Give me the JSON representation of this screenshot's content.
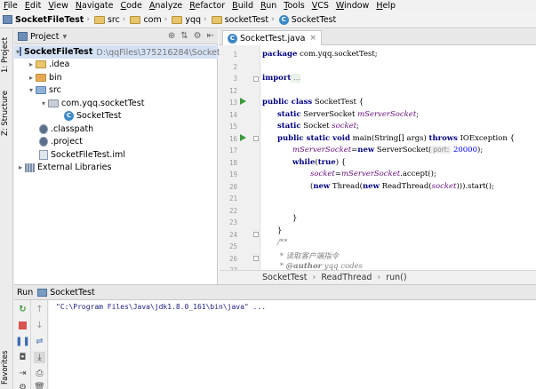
{
  "menu": [
    "File",
    "Edit",
    "View",
    "Navigate",
    "Code",
    "Analyze",
    "Refactor",
    "Build",
    "Run",
    "Tools",
    "VCS",
    "Window",
    "Help"
  ],
  "breadcrumbs": [
    "SocketFileTest",
    "src",
    "com",
    "yqq",
    "socketTest",
    "SocketTest"
  ],
  "left_strip": {
    "project_tab": "1: Project",
    "structure_tab": "Z: Structure",
    "favorites_tab": "Favorites"
  },
  "project_panel": {
    "title": "Project",
    "root_name": "SocketFileTest",
    "root_path": "D:\\qqFiles\\375216284\\Socket通信",
    "items": [
      {
        "label": ".idea"
      },
      {
        "label": "bin"
      },
      {
        "label": "src"
      },
      {
        "label": "com.yqq.socketTest"
      },
      {
        "label": "SocketTest"
      },
      {
        "label": ".classpath"
      },
      {
        "label": ".project"
      },
      {
        "label": "SocketFileTest.iml"
      },
      {
        "label": "External Libraries"
      }
    ]
  },
  "editor": {
    "tab_label": "SocketTest.java",
    "line_numbers": [
      "1",
      "2",
      "3",
      "12",
      "13",
      "14",
      "15",
      "16",
      "17",
      "18",
      "19",
      "20",
      "21",
      "22",
      "23",
      "24",
      "25",
      "26",
      "27"
    ],
    "code": {
      "package_kw": "package",
      "package_name": " com.yqq.socketTest;",
      "import_kw": "import",
      "import_rest": " ...",
      "l13_a": "public class",
      "l13_b": " SocketTest {",
      "l14_a": "static",
      "l14_b": " ServerSocket ",
      "l14_c": "mServerSocket",
      "l14_d": ";",
      "l15_a": "static",
      "l15_b": " Socket ",
      "l15_c": "socket",
      "l15_d": ";",
      "l16_a": "public static void",
      "l16_b": " main(String[] args) ",
      "l16_c": "throws",
      "l16_d": " IOException {",
      "l17_a": "mServerSocket",
      "l17_b": "=",
      "l17_c": "new",
      "l17_d": " ServerSocket(",
      "l17_hint": "port:",
      "l17_e": " 20000",
      "l17_f": ");",
      "l18_a": "while",
      "l18_b": "(",
      "l18_c": "true",
      "l18_d": ") {",
      "l19_a": "socket",
      "l19_b": "=",
      "l19_c": "mServerSocket",
      "l19_d": ".accept();",
      "l20_a": "(",
      "l20_b": "new",
      "l20_c": " Thread(",
      "l20_d": "new",
      "l20_e": " ReadThread(",
      "l20_f": "socket",
      "l20_g": "))).start();",
      "l22": "}",
      "l23": "}",
      "l24": "/**",
      "l25": " * 读取客户端指令",
      "l26_a": " * ",
      "l26_b": "@author",
      "l26_c": " yqq codes"
    },
    "breadcrumb": [
      "SocketTest",
      "ReadThread",
      "run()"
    ]
  },
  "run_panel": {
    "label": "Run",
    "config": "SocketTest",
    "console_line": "\"C:\\Program Files\\Java\\jdk1.8.0_161\\bin\\java\" ..."
  },
  "colors": {
    "keyword": "#000080",
    "field": "#660e7a",
    "number": "#0000ff",
    "run_green": "#3c9a3c",
    "selection": "#d5e2f5"
  }
}
